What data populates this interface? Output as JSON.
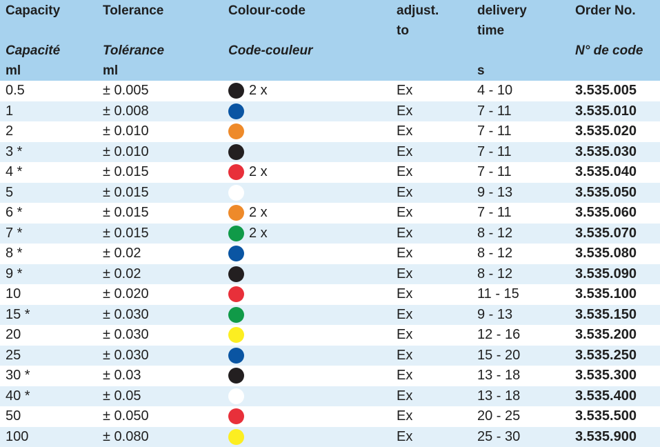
{
  "header": {
    "capacity": "Capacity",
    "tolerance": "Tolerance",
    "colour_code": "Colour-code",
    "adjust_1": "adjust.",
    "adjust_2": "to",
    "delivery_1": "delivery",
    "delivery_2": "time",
    "order_no": "Order No.",
    "capacity_fr": "Capacité",
    "tolerance_fr": "Tolérance",
    "colour_code_fr": "Code-couleur",
    "order_no_fr": "N° de code",
    "unit_ml_1": "ml",
    "unit_ml_2": "ml",
    "unit_s": "s"
  },
  "colors": {
    "black": "#231f20",
    "blue": "#0a55a3",
    "orange": "#ee8a2a",
    "red": "#e8303a",
    "white": "#ffffff",
    "green": "#109a48",
    "yellow": "#fcee21"
  },
  "rows": [
    {
      "capacity": "0.5",
      "tolerance": "± 0.005",
      "color": "black",
      "multiplier": "2 x",
      "adjust": "Ex",
      "delivery": "4 - 10",
      "order": "3.535.005"
    },
    {
      "capacity": "1",
      "tolerance": "± 0.008",
      "color": "blue",
      "multiplier": "",
      "adjust": "Ex",
      "delivery": "7 - 11",
      "order": "3.535.010"
    },
    {
      "capacity": "2",
      "tolerance": "± 0.010",
      "color": "orange",
      "multiplier": "",
      "adjust": "Ex",
      "delivery": "7 - 11",
      "order": "3.535.020"
    },
    {
      "capacity": "3 *",
      "tolerance": "± 0.010",
      "color": "black",
      "multiplier": "",
      "adjust": "Ex",
      "delivery": "7 - 11",
      "order": "3.535.030"
    },
    {
      "capacity": "4 *",
      "tolerance": "± 0.015",
      "color": "red",
      "multiplier": "2 x",
      "adjust": "Ex",
      "delivery": "7 - 11",
      "order": "3.535.040"
    },
    {
      "capacity": "5",
      "tolerance": "± 0.015",
      "color": "white",
      "multiplier": "",
      "adjust": "Ex",
      "delivery": "9 - 13",
      "order": "3.535.050"
    },
    {
      "capacity": "6 *",
      "tolerance": "± 0.015",
      "color": "orange",
      "multiplier": "2 x",
      "adjust": "Ex",
      "delivery": "7 - 11",
      "order": "3.535.060"
    },
    {
      "capacity": "7 *",
      "tolerance": "± 0.015",
      "color": "green",
      "multiplier": "2 x",
      "adjust": "Ex",
      "delivery": "8 - 12",
      "order": "3.535.070"
    },
    {
      "capacity": "8 *",
      "tolerance": "± 0.02",
      "color": "blue",
      "multiplier": "",
      "adjust": "Ex",
      "delivery": "8 - 12",
      "order": "3.535.080"
    },
    {
      "capacity": "9 *",
      "tolerance": "± 0.02",
      "color": "black",
      "multiplier": "",
      "adjust": "Ex",
      "delivery": "8 - 12",
      "order": "3.535.090"
    },
    {
      "capacity": "10",
      "tolerance": "± 0.020",
      "color": "red",
      "multiplier": "",
      "adjust": "Ex",
      "delivery": "11 - 15",
      "order": "3.535.100"
    },
    {
      "capacity": "15 *",
      "tolerance": "± 0.030",
      "color": "green",
      "multiplier": "",
      "adjust": "Ex",
      "delivery": "9 - 13",
      "order": "3.535.150"
    },
    {
      "capacity": "20",
      "tolerance": "± 0.030",
      "color": "yellow",
      "multiplier": "",
      "adjust": "Ex",
      "delivery": "12 - 16",
      "order": "3.535.200"
    },
    {
      "capacity": "25",
      "tolerance": "± 0.030",
      "color": "blue",
      "multiplier": "",
      "adjust": "Ex",
      "delivery": "15 - 20",
      "order": "3.535.250"
    },
    {
      "capacity": "30 *",
      "tolerance": "± 0.03",
      "color": "black",
      "multiplier": "",
      "adjust": "Ex",
      "delivery": "13 - 18",
      "order": "3.535.300"
    },
    {
      "capacity": "40 *",
      "tolerance": "± 0.05",
      "color": "white",
      "multiplier": "",
      "adjust": "Ex",
      "delivery": "13 - 18",
      "order": "3.535.400"
    },
    {
      "capacity": "50",
      "tolerance": "± 0.050",
      "color": "red",
      "multiplier": "",
      "adjust": "Ex",
      "delivery": "20 - 25",
      "order": "3.535.500"
    },
    {
      "capacity": "100",
      "tolerance": "± 0.080",
      "color": "yellow",
      "multiplier": "",
      "adjust": "Ex",
      "delivery": "25 - 30",
      "order": "3.535.900"
    }
  ]
}
